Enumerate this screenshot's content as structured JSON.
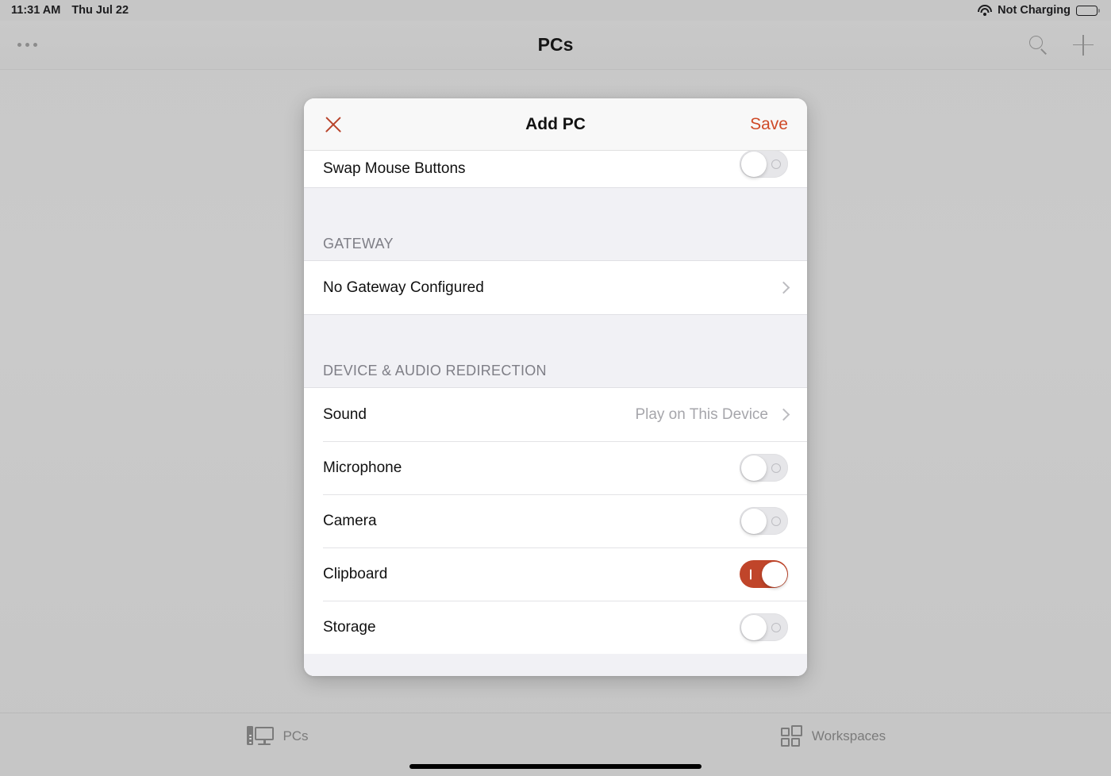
{
  "status_bar": {
    "time": "11:31 AM",
    "date": "Thu Jul 22",
    "wifi_icon": "wifi-icon",
    "battery_label": "Not Charging",
    "battery_icon": "battery-full-icon"
  },
  "nav_bar": {
    "more_icon": "more-ellipsis-icon",
    "title": "PCs",
    "search_icon": "search-icon",
    "add_icon": "plus-icon"
  },
  "modal": {
    "close_icon": "close-x-icon",
    "title": "Add PC",
    "save_label": "Save",
    "rows_top": [
      {
        "label": "Swap Mouse Buttons",
        "control": "toggle",
        "value": "off"
      }
    ],
    "sections": [
      {
        "header": "GATEWAY",
        "rows": [
          {
            "label": "No Gateway Configured",
            "control": "chevron",
            "value": ""
          }
        ]
      },
      {
        "header": "DEVICE & AUDIO REDIRECTION",
        "rows": [
          {
            "label": "Sound",
            "control": "value-chevron",
            "value": "Play on This Device"
          },
          {
            "label": "Microphone",
            "control": "toggle",
            "value": "off"
          },
          {
            "label": "Camera",
            "control": "toggle",
            "value": "off"
          },
          {
            "label": "Clipboard",
            "control": "toggle",
            "value": "on"
          },
          {
            "label": "Storage",
            "control": "toggle",
            "value": "off"
          }
        ]
      }
    ]
  },
  "tab_bar": {
    "tabs": [
      {
        "label": "PCs",
        "icon": "desktop-pc-icon"
      },
      {
        "label": "Workspaces",
        "icon": "grid-squares-icon"
      }
    ]
  },
  "colors": {
    "accent_red": "#c0452a",
    "save_red": "#cf4a27",
    "section_bg": "#f1f1f5",
    "backdrop": "#c8c8c8"
  }
}
